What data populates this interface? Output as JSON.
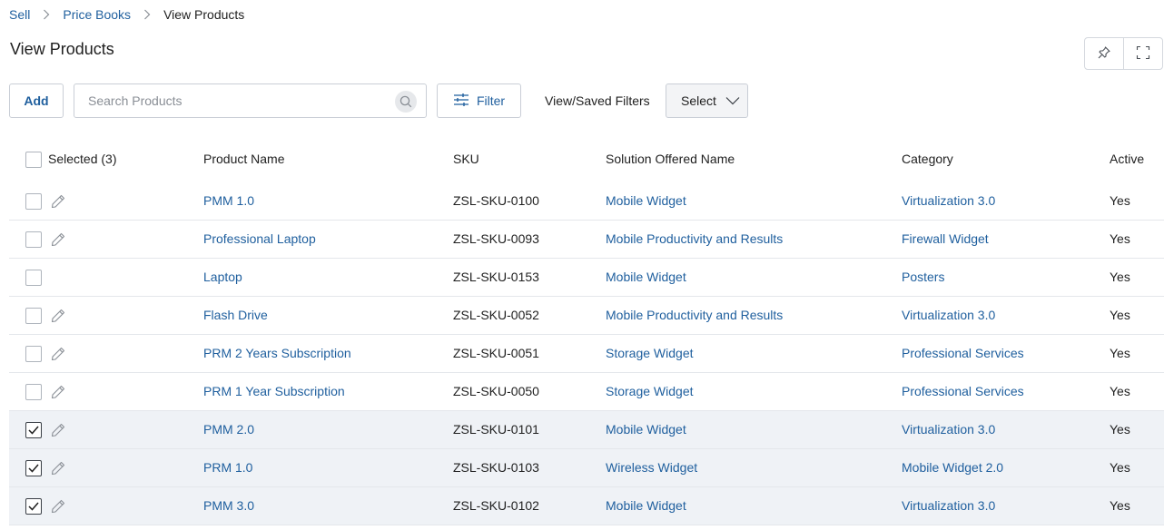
{
  "breadcrumb": {
    "items": [
      {
        "label": "Sell",
        "link": true
      },
      {
        "label": "Price Books",
        "link": true
      },
      {
        "label": "View Products",
        "link": false
      }
    ]
  },
  "page": {
    "title": "View Products"
  },
  "header_actions": {
    "icons": [
      "pin-icon",
      "fullscreen-icon"
    ]
  },
  "toolbar": {
    "add_label": "Add",
    "search_placeholder": "Search Products",
    "search_value": "",
    "filter_label": "Filter",
    "saved_filters_label": "View/Saved Filters",
    "select_value": "Select"
  },
  "table": {
    "columns": {
      "selected": "Selected (3)",
      "product_name": "Product Name",
      "sku": "SKU",
      "solution": "Solution Offered Name",
      "category": "Category",
      "active": "Active"
    },
    "rows": [
      {
        "name": "PMM 1.0",
        "sku": "ZSL-SKU-0100",
        "solution": "Mobile Widget",
        "category": "Virtualization 3.0",
        "active": "Yes",
        "checked": false,
        "editable": true
      },
      {
        "name": "Professional Laptop",
        "sku": "ZSL-SKU-0093",
        "solution": "Mobile Productivity and Results",
        "category": "Firewall Widget",
        "active": "Yes",
        "checked": false,
        "editable": true
      },
      {
        "name": "Laptop",
        "sku": "ZSL-SKU-0153",
        "solution": "Mobile Widget",
        "category": "Posters",
        "active": "Yes",
        "checked": false,
        "editable": false
      },
      {
        "name": "Flash Drive",
        "sku": "ZSL-SKU-0052",
        "solution": "Mobile Productivity and Results",
        "category": "Virtualization 3.0",
        "active": "Yes",
        "checked": false,
        "editable": true
      },
      {
        "name": "PRM 2 Years Subscription",
        "sku": "ZSL-SKU-0051",
        "solution": "Storage Widget",
        "category": "Professional Services",
        "active": "Yes",
        "checked": false,
        "editable": true
      },
      {
        "name": "PRM 1 Year Subscription",
        "sku": "ZSL-SKU-0050",
        "solution": "Storage Widget",
        "category": "Professional Services",
        "active": "Yes",
        "checked": false,
        "editable": true
      },
      {
        "name": "PMM 2.0",
        "sku": "ZSL-SKU-0101",
        "solution": "Mobile Widget",
        "category": "Virtualization 3.0",
        "active": "Yes",
        "checked": true,
        "editable": true
      },
      {
        "name": "PRM 1.0",
        "sku": "ZSL-SKU-0103",
        "solution": "Wireless Widget",
        "category": "Mobile Widget 2.0",
        "active": "Yes",
        "checked": true,
        "editable": true
      },
      {
        "name": "PMM 3.0",
        "sku": "ZSL-SKU-0102",
        "solution": "Mobile Widget",
        "category": "Virtualization 3.0",
        "active": "Yes",
        "checked": true,
        "editable": true
      }
    ]
  },
  "colors": {
    "link": "#1f5f9e",
    "selected_row_bg": "#eff2f6",
    "border": "#e4e7eb"
  }
}
